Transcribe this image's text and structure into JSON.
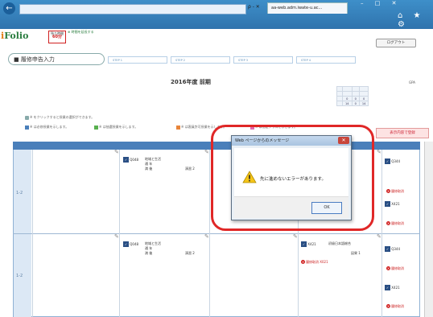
{
  "browser": {
    "back_icon": "back-arrow-icon",
    "address": "",
    "tab_title": "aa-web.adm.iwate-u.ac...",
    "address_tools": "ρ - ✕",
    "window_controls": "– □ ✕",
    "icons": "⌂ ★ ⚙"
  },
  "header": {
    "logo": "Folio",
    "timer_label": "残り時間",
    "timer_value": "60分",
    "time_extend": "⊕ 時間を延長する",
    "user_info": "",
    "logout": "ログアウト"
  },
  "page": {
    "title": "■ 履修申告入力",
    "steps": [
      "STEP 1",
      "STEP 2",
      "STEP 3",
      "STEP 4"
    ],
    "term": "2016年度 前期"
  },
  "credits": {
    "label": "GPA",
    "header": [
      "",
      "",
      "",
      ""
    ],
    "rows": [
      [
        "",
        "",
        "",
        ""
      ],
      [
        "",
        "0",
        "0",
        "0"
      ],
      [
        "",
        "14",
        "0",
        "14"
      ]
    ]
  },
  "notes": {
    "line1": "※ をクリックすると授業の選択ができます。",
    "line2a": "※ は必修授業を示します。",
    "line2b": "※ は抽選授業を示します。",
    "line2c": "※ は客員許可授業を示します。",
    "line2d": "※ は指定クラスを示します。",
    "confirm": "表示内容で登録"
  },
  "grid": {
    "headers": [
      "",
      "",
      "",
      "",
      "",
      ""
    ],
    "period": "1-2",
    "course_code": "Q048",
    "course_name": "地域と生活",
    "course_line2": "通 年",
    "course_line3": "満 後",
    "course_extra": "演習 2",
    "right_code_1": "Q344",
    "right_code_2": "X421",
    "mid_code": "X421",
    "mid_name": "初級日本語総合",
    "mid_extra": "因果 1",
    "mid_link": "履修取消 X021",
    "right_link": "履修取消"
  },
  "dialog": {
    "title": "Web ページからのメッセージ",
    "message": "先に進めないエラーがあります。",
    "ok": "OK"
  },
  "colors": {
    "accent": "#2f73ad",
    "highlight": "#e02727",
    "brand_green": "#2a7d3f"
  }
}
